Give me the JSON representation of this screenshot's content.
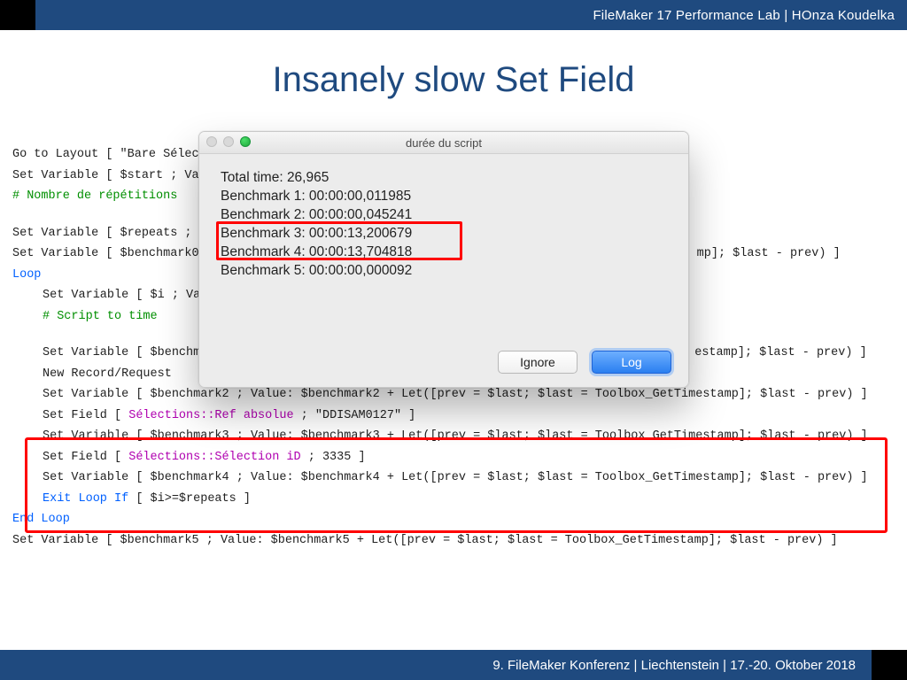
{
  "header": {
    "text": "FileMaker 17 Performance Lab | HOnza Koudelka"
  },
  "footer": {
    "text": "9.  FileMaker Konferenz | Liechtenstein |  17.-20. Oktober 2018"
  },
  "title": "Insanely slow Set Field",
  "script": {
    "l1": "Go to Layout [ \"Bare Sélec",
    "l2": "Set Variable [ $start ; Val",
    "l3": "# Nombre de répétitions",
    "l4": "Set Variable [ $repeats ; V",
    "l5_a": "Set Variable [ $benchmark0",
    "l5_b": "mp]; $last - prev) ]",
    "l6": "Loop",
    "l7": "Set Variable [ $i ; Val",
    "l8": "# Script to time",
    "l9_a": "Set Variable [ $benchm",
    "l9_b": "estamp]; $last - prev) ]",
    "l10": "New Record/Request",
    "l11": "Set Variable [ $benchmark2 ; Value: $benchmark2 + Let([prev = $last; $last = Toolbox_GetTimestamp]; $last - prev) ]",
    "l12_a": "Set Field [ ",
    "l12_b": "Sélections::Ref absolue",
    "l12_c": " ; \"DDISAM0127\" ]",
    "l13": "Set Variable [ $benchmark3 ; Value: $benchmark3 + Let([prev = $last; $last = Toolbox_GetTimestamp]; $last - prev) ]",
    "l14_a": "Set Field [ ",
    "l14_b": "Sélections::Sélection iD",
    "l14_c": " ; 3335 ]",
    "l15": "Set Variable [ $benchmark4 ; Value: $benchmark4 + Let([prev = $last; $last = Toolbox_GetTimestamp]; $last - prev) ]",
    "l16_a": "Exit Loop If",
    "l16_b": " [ $i>=$repeats ]",
    "l17": "End Loop",
    "l18": "Set Variable [ $benchmark5 ; Value: $benchmark5 + Let([prev = $last; $last = Toolbox_GetTimestamp]; $last - prev) ]"
  },
  "dialog": {
    "title": "durée du script",
    "total": "Total time: 26,965",
    "b1": "Benchmark 1: 00:00:00,011985",
    "b2": "Benchmark 2: 00:00:00,045241",
    "b3": "Benchmark 3: 00:00:13,200679",
    "b4": "Benchmark 4: 00:00:13,704818",
    "b5": "Benchmark 5: 00:00:00,000092",
    "ignore": "Ignore",
    "log": "Log"
  }
}
